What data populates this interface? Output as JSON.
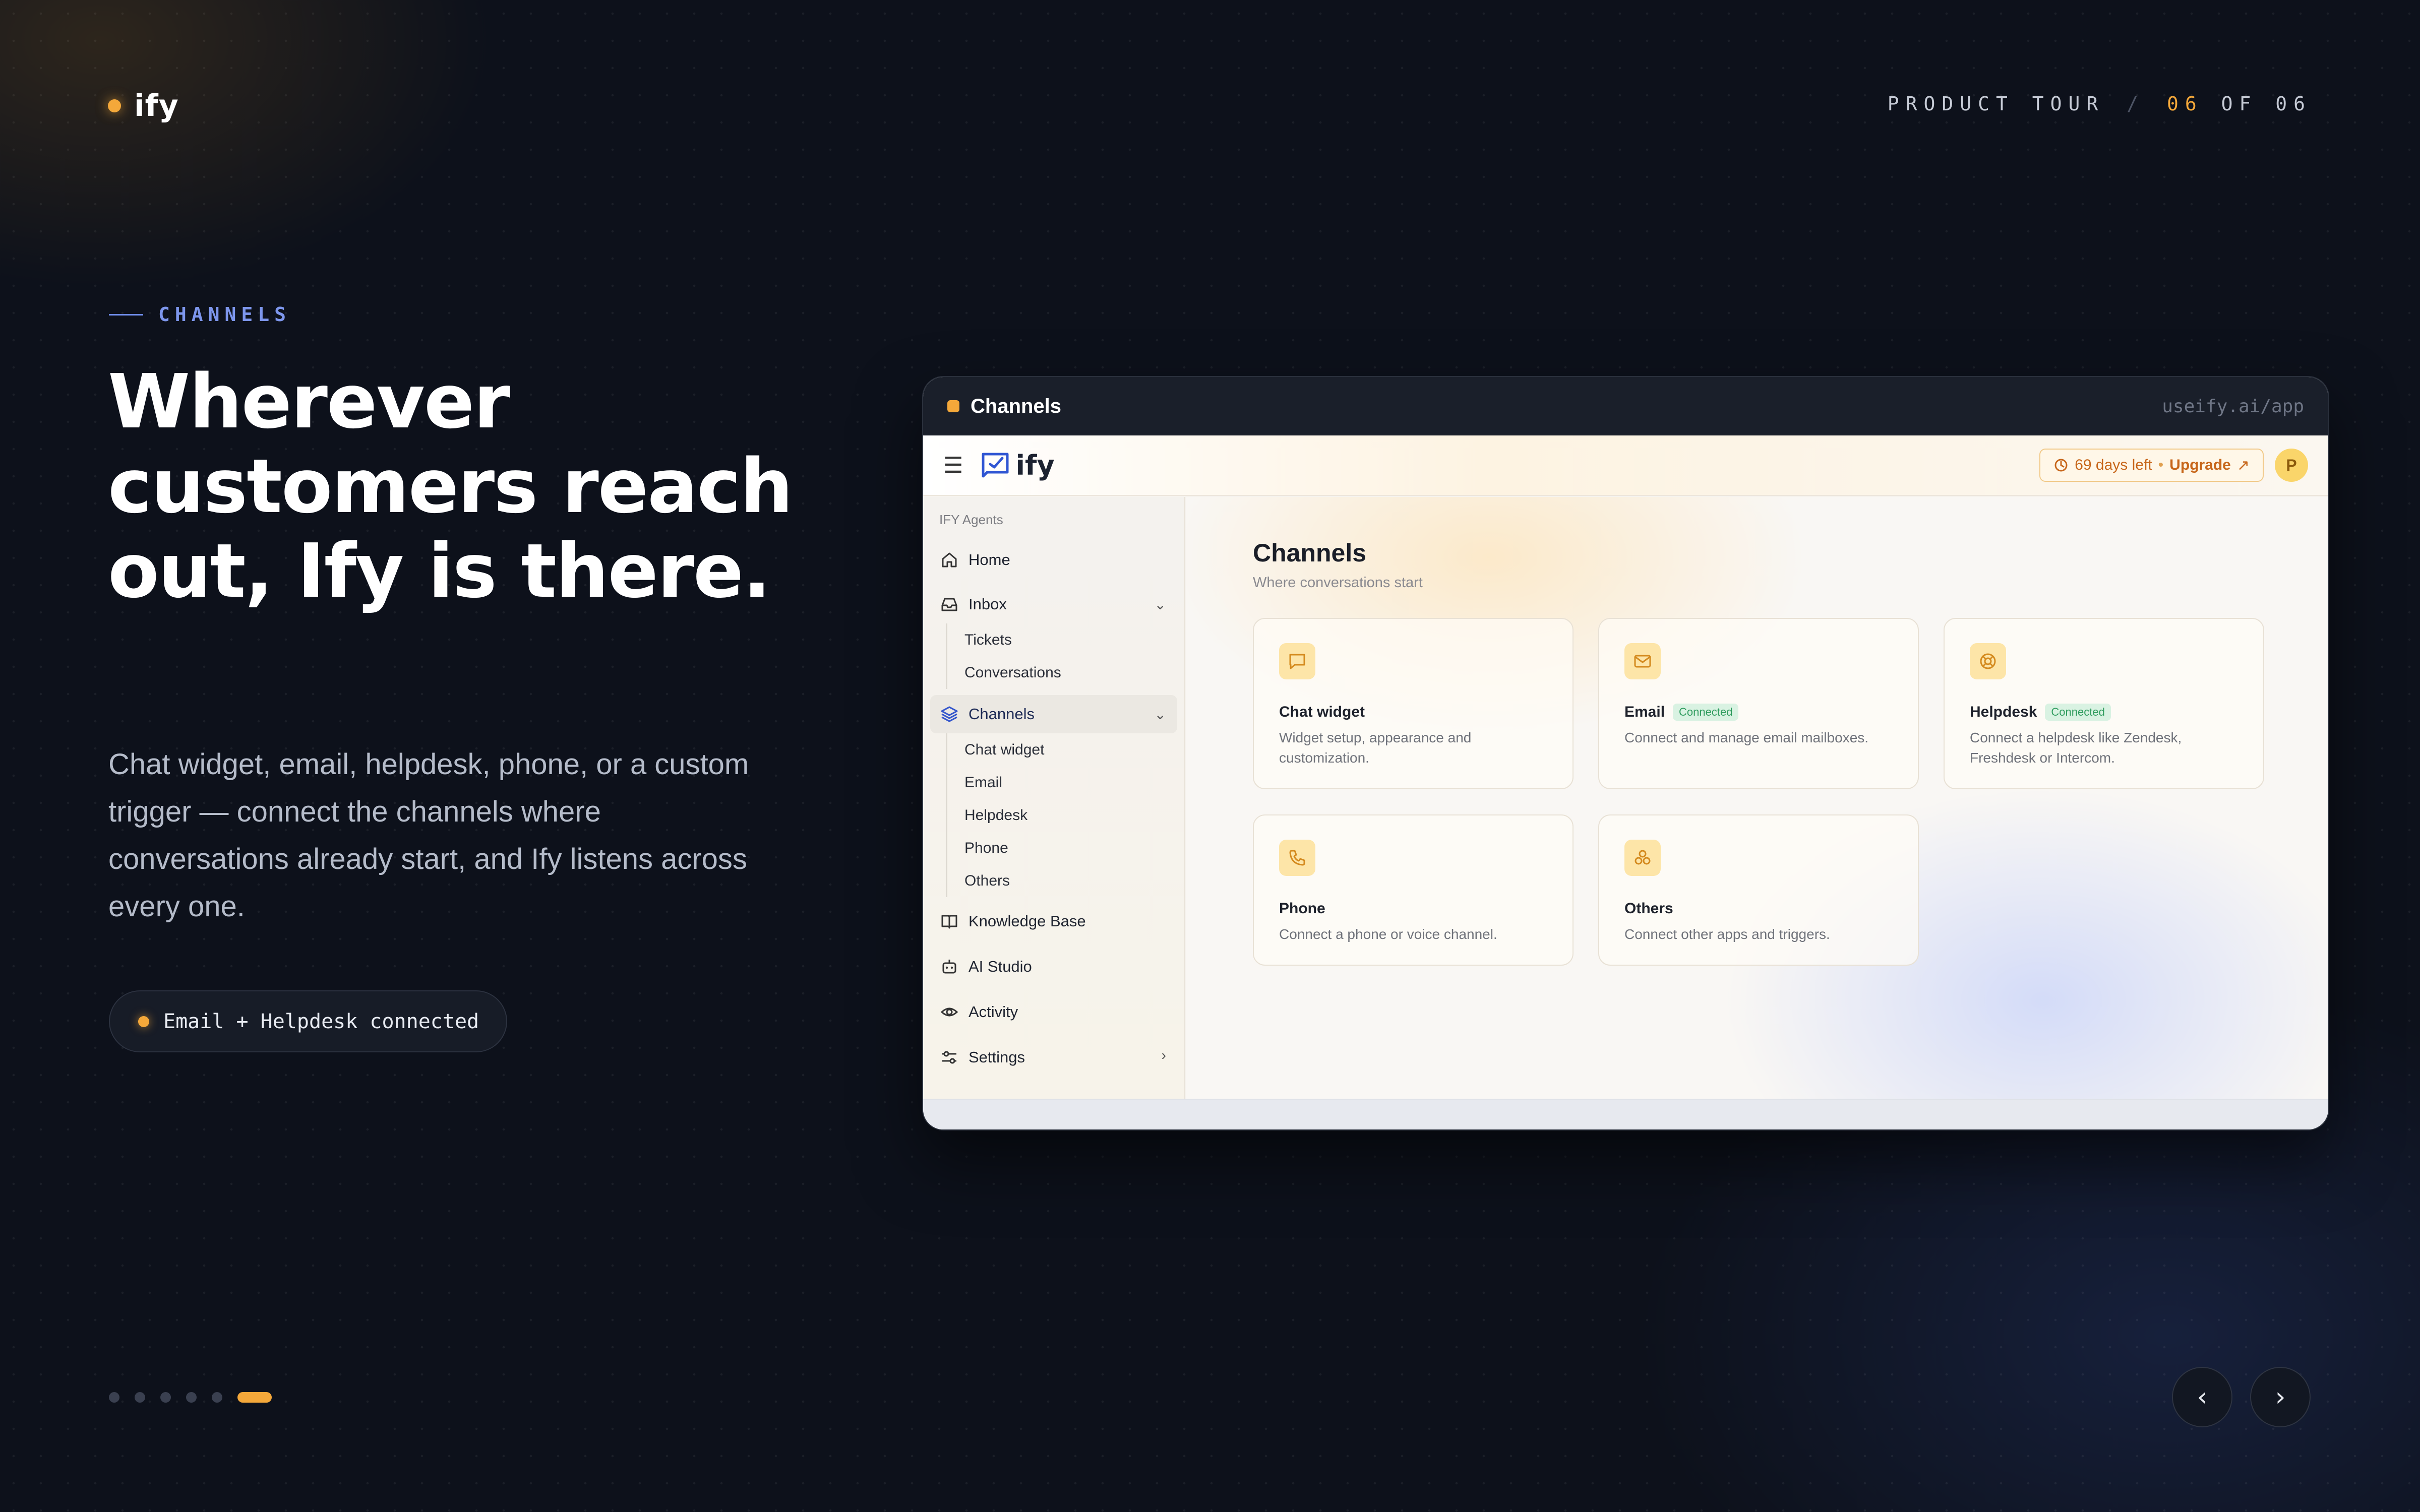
{
  "brand": {
    "name": "ify"
  },
  "tour": {
    "label": "PRODUCT TOUR",
    "separator": "/",
    "current": "06",
    "of": "OF 06"
  },
  "hero": {
    "eyebrow": "CHANNELS",
    "headline": "Wherever customers reach out, Ify is there.",
    "subtext": "Chat widget, email, helpdesk, phone, or a custom trigger — connect the channels where conversations already start, and Ify listens across every one.",
    "status_pill": "Email + Helpdesk connected"
  },
  "pagination": {
    "total": 6,
    "active_index": 6
  },
  "window": {
    "title": "Channels",
    "url": "useify.ai/app"
  },
  "app": {
    "logo_text": "ify",
    "trial_text": "69 days left",
    "trial_sep": "•",
    "upgrade_label": "Upgrade",
    "avatar_initial": "P",
    "sidebar": {
      "section": "IFY Agents",
      "home": "Home",
      "inbox": "Inbox",
      "inbox_items": [
        "Tickets",
        "Conversations"
      ],
      "channels": "Channels",
      "channel_items": [
        "Chat widget",
        "Email",
        "Helpdesk",
        "Phone",
        "Others"
      ],
      "knowledge_base": "Knowledge Base",
      "ai_studio": "AI Studio",
      "activity": "Activity",
      "settings": "Settings"
    },
    "main": {
      "title": "Channels",
      "subtitle": "Where conversations start",
      "cards": [
        {
          "name": "Chat widget",
          "badge": "",
          "desc": "Widget setup, appearance and customization.",
          "icon": "chat-bubble-icon"
        },
        {
          "name": "Email",
          "badge": "Connected",
          "desc": "Connect and manage email mailboxes.",
          "icon": "mail-icon"
        },
        {
          "name": "Helpdesk",
          "badge": "Connected",
          "desc": "Connect a helpdesk like Zendesk, Freshdesk or Intercom.",
          "icon": "lifebuoy-icon"
        },
        {
          "name": "Phone",
          "badge": "",
          "desc": "Connect a phone or voice channel.",
          "icon": "phone-icon"
        },
        {
          "name": "Others",
          "badge": "",
          "desc": "Connect other apps and triggers.",
          "icon": "apps-icon"
        }
      ]
    }
  },
  "colors": {
    "accent": "#f4a83a",
    "eyebrow": "#7d96ec",
    "background": "#0d111b"
  }
}
